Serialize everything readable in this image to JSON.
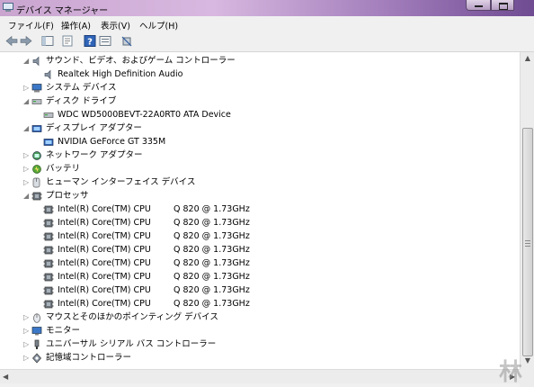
{
  "window": {
    "title": "デバイス マネージャー"
  },
  "menu": [
    {
      "label": "ファイル(F)",
      "name": "menu-file"
    },
    {
      "label": "操作(A)",
      "name": "menu-action"
    },
    {
      "label": "表示(V)",
      "name": "menu-view"
    },
    {
      "label": "ヘルプ(H)",
      "name": "menu-help"
    }
  ],
  "toolbar": [
    {
      "name": "back-arrow-icon"
    },
    {
      "name": "forward-arrow-icon"
    },
    {
      "name": "console-tree-icon"
    },
    {
      "name": "properties-icon"
    },
    {
      "name": "help-icon"
    },
    {
      "name": "device-view-icon"
    },
    {
      "name": "scan-hardware-icon"
    }
  ],
  "tree": [
    {
      "label": "サウンド、ビデオ、およびゲーム コントローラー",
      "level": 0,
      "state": "expanded",
      "icon": "speaker-icon"
    },
    {
      "label": "Realtek High Definition Audio",
      "level": 1,
      "state": "leaf",
      "icon": "speaker-icon"
    },
    {
      "label": "システム デバイス",
      "level": 0,
      "state": "collapsed",
      "icon": "computer-icon"
    },
    {
      "label": "ディスク ドライブ",
      "level": 0,
      "state": "expanded",
      "icon": "disk-drive-icon"
    },
    {
      "label": "WDC WD5000BEVT-22A0RT0 ATA Device",
      "level": 1,
      "state": "leaf",
      "icon": "disk-drive-icon"
    },
    {
      "label": "ディスプレイ アダプター",
      "level": 0,
      "state": "expanded",
      "icon": "display-adapter-icon"
    },
    {
      "label": "NVIDIA GeForce GT 335M",
      "level": 1,
      "state": "leaf",
      "icon": "display-adapter-icon"
    },
    {
      "label": "ネットワーク アダプター",
      "level": 0,
      "state": "collapsed",
      "icon": "network-icon"
    },
    {
      "label": "バッテリ",
      "level": 0,
      "state": "collapsed",
      "icon": "battery-icon"
    },
    {
      "label": "ヒューマン インターフェイス デバイス",
      "level": 0,
      "state": "collapsed",
      "icon": "hid-icon"
    },
    {
      "label": "プロセッサ",
      "level": 0,
      "state": "expanded",
      "icon": "processor-icon"
    },
    {
      "label": "Intel(R) Core(TM) CPU",
      "suffix": "Q 820  @ 1.73GHz",
      "level": 1,
      "state": "leaf",
      "icon": "processor-icon"
    },
    {
      "label": "Intel(R) Core(TM) CPU",
      "suffix": "Q 820  @ 1.73GHz",
      "level": 1,
      "state": "leaf",
      "icon": "processor-icon"
    },
    {
      "label": "Intel(R) Core(TM) CPU",
      "suffix": "Q 820  @ 1.73GHz",
      "level": 1,
      "state": "leaf",
      "icon": "processor-icon"
    },
    {
      "label": "Intel(R) Core(TM) CPU",
      "suffix": "Q 820  @ 1.73GHz",
      "level": 1,
      "state": "leaf",
      "icon": "processor-icon"
    },
    {
      "label": "Intel(R) Core(TM) CPU",
      "suffix": "Q 820  @ 1.73GHz",
      "level": 1,
      "state": "leaf",
      "icon": "processor-icon"
    },
    {
      "label": "Intel(R) Core(TM) CPU",
      "suffix": "Q 820  @ 1.73GHz",
      "level": 1,
      "state": "leaf",
      "icon": "processor-icon"
    },
    {
      "label": "Intel(R) Core(TM) CPU",
      "suffix": "Q 820  @ 1.73GHz",
      "level": 1,
      "state": "leaf",
      "icon": "processor-icon"
    },
    {
      "label": "Intel(R) Core(TM) CPU",
      "suffix": "Q 820  @ 1.73GHz",
      "level": 1,
      "state": "leaf",
      "icon": "processor-icon"
    },
    {
      "label": "マウスとそのほかのポインティング デバイス",
      "level": 0,
      "state": "collapsed",
      "icon": "mouse-icon"
    },
    {
      "label": "モニター",
      "level": 0,
      "state": "collapsed",
      "icon": "monitor-icon"
    },
    {
      "label": "ユニバーサル シリアル バス コントローラー",
      "level": 0,
      "state": "collapsed",
      "icon": "usb-icon"
    },
    {
      "label": "記憶域コントローラー",
      "level": 0,
      "state": "collapsed",
      "icon": "storage-controller-icon"
    }
  ],
  "watermark": "林",
  "colors": {
    "titlebar_start": "#c9a5cf",
    "titlebar_end": "#6f4b92",
    "chrome": "#f0f0f0"
  }
}
